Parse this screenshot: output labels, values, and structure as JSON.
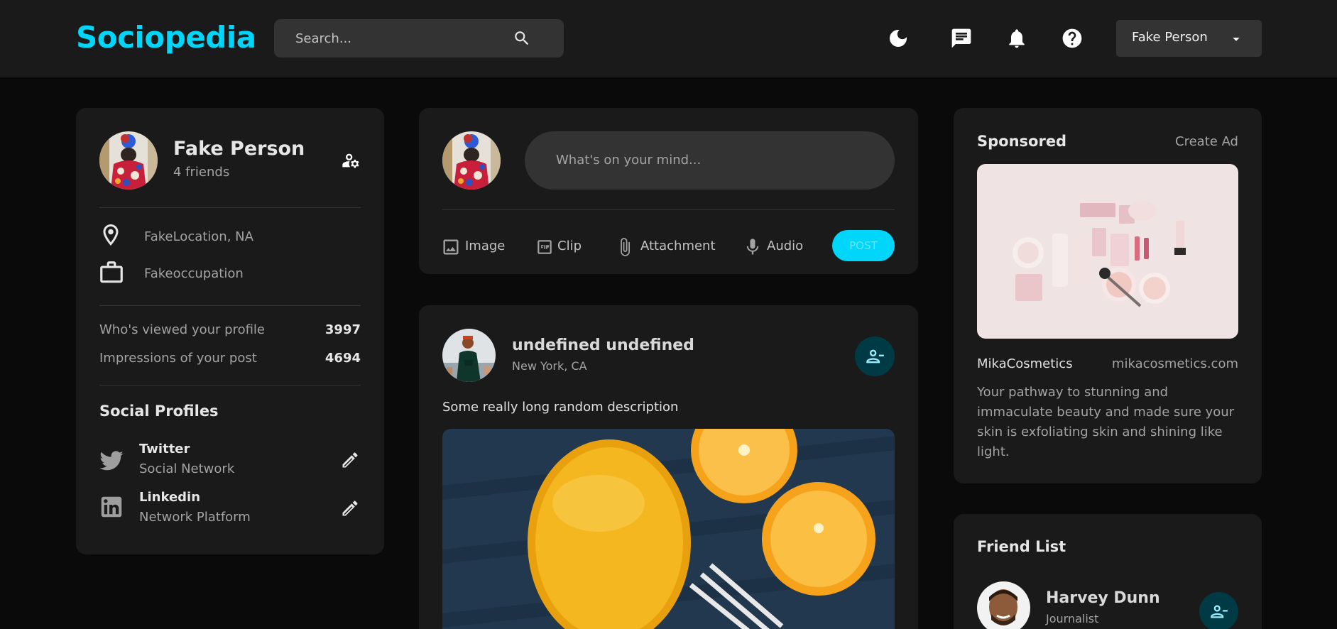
{
  "header": {
    "logo": "Sociopedia",
    "search_placeholder": "Search...",
    "icons": [
      "moon-icon",
      "message-icon",
      "bell-icon",
      "help-icon"
    ],
    "user_select": "Fake Person"
  },
  "profile": {
    "name": "Fake Person",
    "friends": "4 friends",
    "location": "FakeLocation, NA",
    "occupation": "Fakeoccupation",
    "stats": [
      {
        "label": "Who's viewed your profile",
        "value": "3997"
      },
      {
        "label": "Impressions of your post",
        "value": "4694"
      }
    ],
    "social_title": "Social Profiles",
    "socials": [
      {
        "name": "Twitter",
        "desc": "Social Network",
        "icon": "twitter-icon"
      },
      {
        "name": "Linkedin",
        "desc": "Network Platform",
        "icon": "linkedin-icon"
      }
    ]
  },
  "composer": {
    "placeholder": "What's on your mind...",
    "actions": [
      {
        "label": "Image",
        "icon": "image-icon"
      },
      {
        "label": "Clip",
        "icon": "gif-icon"
      },
      {
        "label": "Attachment",
        "icon": "paperclip-icon"
      },
      {
        "label": "Audio",
        "icon": "microphone-icon"
      }
    ],
    "post_button": "POST"
  },
  "post": {
    "author": "undefined undefined",
    "location": "New York, CA",
    "description": "Some really long random description"
  },
  "sponsored": {
    "title": "Sponsored",
    "create_ad": "Create Ad",
    "brand": "MikaCosmetics",
    "url": "mikacosmetics.com",
    "description": "Your pathway to stunning and immaculate beauty and made sure your skin is exfoliating skin and shining like light."
  },
  "friend_list": {
    "title": "Friend List",
    "friends": [
      {
        "name": "Harvey Dunn",
        "occupation": "Journalist"
      }
    ]
  },
  "colors": {
    "accent": "#00d5fa",
    "background": "#0a0a0a",
    "card": "#1a1a1a",
    "input": "#333333",
    "remove_friend_bg": "#003a45"
  }
}
